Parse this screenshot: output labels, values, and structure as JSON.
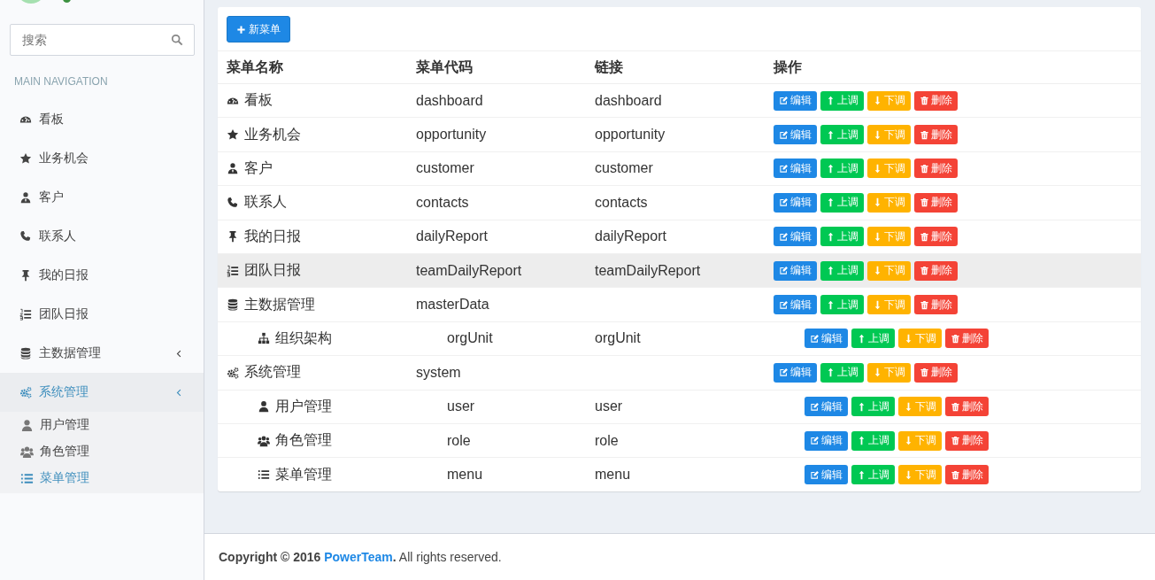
{
  "sidebar": {
    "search": {
      "placeholder": "搜索"
    },
    "header": "MAIN NAVIGATION",
    "items": [
      {
        "label": "看板",
        "selected": false
      },
      {
        "label": "业务机会",
        "selected": false
      },
      {
        "label": "客户",
        "selected": false
      },
      {
        "label": "联系人",
        "selected": false
      },
      {
        "label": "我的日报",
        "selected": false
      },
      {
        "label": "团队日报",
        "selected": false
      },
      {
        "label": "主数据管理",
        "selected": false,
        "expanded": false
      },
      {
        "label": "系统管理",
        "selected": true,
        "expanded": true,
        "children": [
          {
            "label": "用户管理",
            "selected": false
          },
          {
            "label": "角色管理",
            "selected": false
          },
          {
            "label": "菜单管理",
            "selected": true
          }
        ]
      }
    ]
  },
  "toolbar": {
    "new_button": "新菜单"
  },
  "table": {
    "columns": [
      "菜单名称",
      "菜单代码",
      "链接",
      "操作"
    ],
    "rows": [
      {
        "name": "看板",
        "code": "dashboard",
        "link": "dashboard",
        "hovered": false,
        "actions": [
          {
            "kind": "edit",
            "label": "编辑"
          },
          {
            "kind": "up",
            "label": "上调"
          },
          {
            "kind": "down",
            "label": "下调"
          },
          {
            "kind": "delete",
            "label": "删除"
          }
        ]
      },
      {
        "name": "业务机会",
        "code": "opportunity",
        "link": "opportunity",
        "hovered": false,
        "actions": [
          {
            "kind": "edit",
            "label": "编辑"
          },
          {
            "kind": "up",
            "label": "上调"
          },
          {
            "kind": "down",
            "label": "下调"
          },
          {
            "kind": "delete",
            "label": "删除"
          }
        ]
      },
      {
        "name": "客户",
        "code": "customer",
        "link": "customer",
        "hovered": false,
        "actions": [
          {
            "kind": "edit",
            "label": "编辑"
          },
          {
            "kind": "up",
            "label": "上调"
          },
          {
            "kind": "down",
            "label": "下调"
          },
          {
            "kind": "delete",
            "label": "删除"
          }
        ]
      },
      {
        "name": "联系人",
        "code": "contacts",
        "link": "contacts",
        "hovered": false,
        "actions": [
          {
            "kind": "edit",
            "label": "编辑"
          },
          {
            "kind": "up",
            "label": "上调"
          },
          {
            "kind": "down",
            "label": "下调"
          },
          {
            "kind": "delete",
            "label": "删除"
          }
        ]
      },
      {
        "name": "我的日报",
        "code": "dailyReport",
        "link": "dailyReport",
        "hovered": false,
        "actions": [
          {
            "kind": "edit",
            "label": "编辑"
          },
          {
            "kind": "up",
            "label": "上调"
          },
          {
            "kind": "down",
            "label": "下调"
          },
          {
            "kind": "delete",
            "label": "删除"
          }
        ]
      },
      {
        "name": "团队日报",
        "code": "teamDailyReport",
        "link": "teamDailyReport",
        "hovered": true,
        "actions": [
          {
            "kind": "edit",
            "label": "编辑"
          },
          {
            "kind": "up",
            "label": "上调"
          },
          {
            "kind": "down",
            "label": "下调"
          },
          {
            "kind": "delete",
            "label": "删除"
          }
        ]
      },
      {
        "name": "主数据管理",
        "code": "masterData",
        "hovered": false,
        "actions": [
          {
            "kind": "edit",
            "label": "编辑"
          },
          {
            "kind": "up",
            "label": "上调"
          },
          {
            "kind": "down",
            "label": "下调"
          },
          {
            "kind": "delete",
            "label": "删除"
          }
        ],
        "children": [
          {
            "name": "组织架构",
            "code": "orgUnit",
            "link": "orgUnit",
            "hovered": false,
            "actions": [
              {
                "kind": "edit",
                "label": "编辑"
              },
              {
                "kind": "up",
                "label": "上调"
              },
              {
                "kind": "down",
                "label": "下调"
              },
              {
                "kind": "delete",
                "label": "删除"
              }
            ]
          }
        ]
      },
      {
        "name": "系统管理",
        "code": "system",
        "hovered": false,
        "actions": [
          {
            "kind": "edit",
            "label": "编辑"
          },
          {
            "kind": "up",
            "label": "上调"
          },
          {
            "kind": "down",
            "label": "下调"
          },
          {
            "kind": "delete",
            "label": "删除"
          }
        ],
        "children": [
          {
            "name": "用户管理",
            "code": "user",
            "link": "user",
            "hovered": false,
            "actions": [
              {
                "kind": "edit",
                "label": "编辑"
              },
              {
                "kind": "up",
                "label": "上调"
              },
              {
                "kind": "down",
                "label": "下调"
              },
              {
                "kind": "delete",
                "label": "删除"
              }
            ]
          },
          {
            "name": "角色管理",
            "code": "role",
            "link": "role",
            "hovered": false,
            "actions": [
              {
                "kind": "edit",
                "label": "编辑"
              },
              {
                "kind": "up",
                "label": "上调"
              },
              {
                "kind": "down",
                "label": "下调"
              },
              {
                "kind": "delete",
                "label": "删除"
              }
            ]
          },
          {
            "name": "菜单管理",
            "code": "menu",
            "link": "menu",
            "hovered": false,
            "actions": [
              {
                "kind": "edit",
                "label": "编辑"
              },
              {
                "kind": "up",
                "label": "上调"
              },
              {
                "kind": "down",
                "label": "下调"
              },
              {
                "kind": "delete",
                "label": "删除"
              }
            ]
          }
        ]
      }
    ]
  },
  "footer": {
    "lead": "Copyright © 2016",
    "link": "PowerTeam",
    "trail": "**.** All rights reserved."
  }
}
